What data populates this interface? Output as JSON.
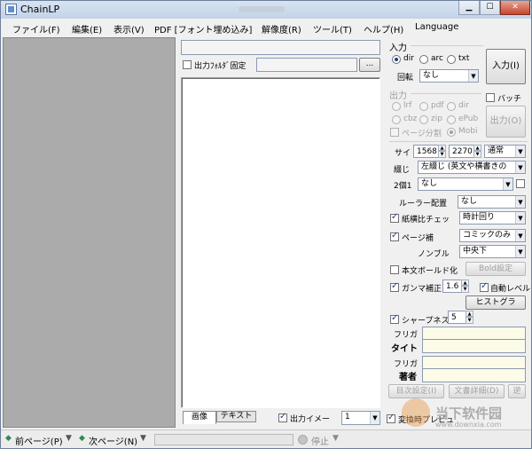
{
  "window": {
    "title": "ChainLP",
    "minimize_glyph": "▁",
    "maximize_glyph": "☐",
    "close_glyph": "✕"
  },
  "menu": {
    "items": [
      "ファイル(F)",
      "編集(E)",
      "表示(V)",
      "PDF [フォント埋め込み]",
      "解像度(R)",
      "ツール(T)",
      "ヘルプ(H)",
      "Language"
    ]
  },
  "center": {
    "output_folder_fixed_label": "出力ﾌｫﾙﾀﾞ固定",
    "browse_label": "...",
    "tabs": [
      "画像",
      "テキスト"
    ],
    "output_image_label": "出力イメー",
    "output_image_value": "1"
  },
  "input_group": {
    "title": "入力",
    "radio_dir": "dir",
    "radio_arc": "arc",
    "radio_txt": "txt",
    "rotate_label": "回転",
    "rotate_value": "なし",
    "input_button": "入力(I)"
  },
  "output_group": {
    "title": "出力",
    "radio_lrf": "lrf",
    "radio_pdf": "pdf",
    "radio_dir": "dir",
    "radio_cbz": "cbz",
    "radio_zip": "zip",
    "radio_epub": "ePub",
    "page_split_label": "ページ分割",
    "radio_mobi": "Mobi",
    "batch_label": "バッチ",
    "output_button": "出力(O)"
  },
  "settings": {
    "size_label": "サイ",
    "width_value": "1568",
    "height_value": "2270",
    "size_mode": "通常",
    "binding_label": "綴じ",
    "binding_value": "左綴じ (英文や横書きの",
    "two_page_label": "2個1",
    "two_page_value": "なし",
    "ruler_label": "ルーラー配置",
    "ruler_value": "なし",
    "aspect_label": "紙横比チェッ",
    "aspect_value": "時計回り",
    "page_comp_label": "ページ補",
    "page_comp_value": "コミックのみ",
    "nombre_label": "ノンブル",
    "nombre_value": "中央下",
    "bold_label": "本文ボールド化",
    "bold_button": "Bold設定",
    "gamma_label": "ガンマ補正",
    "gamma_value": "1.6",
    "auto_level_label": "自動レベル",
    "histogram_button": "ヒストグラ",
    "sharpness_label": "シャープネス",
    "sharpness_value": "5",
    "furigana1_label": "フリガ",
    "title_label": "タイト",
    "furigana2_label": "フリガ",
    "author_label": "著者",
    "toc_button": "目次設定(I)",
    "book_detail_button": "文書詳細(D)",
    "reverse_button": "逆",
    "preview_label": "変換時プレビュ"
  },
  "status": {
    "prev_page": "前ページ(P)",
    "next_page": "次ページ(N)",
    "stop_label": "停止"
  },
  "watermark": {
    "brand": "当下软件园",
    "url": "www.downxia.com"
  }
}
